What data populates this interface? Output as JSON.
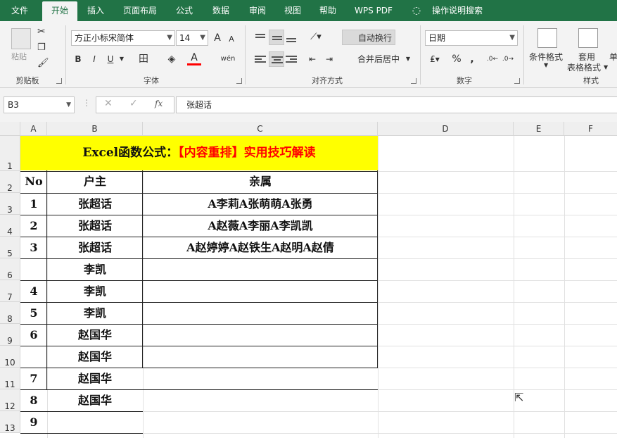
{
  "menu": {
    "tabs": [
      "文件",
      "开始",
      "插入",
      "页面布局",
      "公式",
      "数据",
      "审阅",
      "视图",
      "帮助",
      "WPS PDF",
      "操作说明搜索"
    ]
  },
  "ribbon": {
    "paste_label": "粘贴",
    "font_name": "方正小标宋简体",
    "font_size": "14",
    "grow_font": "A",
    "shrink_font": "A",
    "bold": "B",
    "italic": "I",
    "underline": "U",
    "font_color_a": "A",
    "phonetic": "wén",
    "wrap_text": "自动换行",
    "merge_center": "合并后居中",
    "number_format": "日期",
    "percent": "%",
    "comma": ",",
    "cond_format": "条件格式",
    "format_table_line1": "套用",
    "format_table_line2": "表格格式",
    "cell_styles_partial": "单",
    "groups": {
      "clipboard": "剪贴板",
      "font": "字体",
      "alignment": "对齐方式",
      "number": "数字",
      "styles": "样式"
    }
  },
  "formula_bar": {
    "name_box": "B3",
    "fx": "fx",
    "content": "张超话"
  },
  "sheet": {
    "columns": [
      "A",
      "B",
      "C",
      "D",
      "E",
      "F"
    ],
    "rows": [
      "1",
      "2",
      "3",
      "4",
      "5",
      "6",
      "7",
      "8",
      "9",
      "10",
      "11",
      "12",
      "13"
    ],
    "title_black": "Excel函数公式：",
    "title_red": "【内容重排】实用技巧解读",
    "header": {
      "no": "No",
      "owner": "户主",
      "relatives": "亲属"
    },
    "data_rows": [
      {
        "no": "1",
        "owner": "张超话",
        "relatives": "A李莉A张萌萌A张勇"
      },
      {
        "no": "2",
        "owner": "张超话",
        "relatives": "A赵薇A李丽A李凯凯"
      },
      {
        "no": "3",
        "owner": "张超话",
        "relatives": "A赵婷婷A赵铁生A赵明A赵倩"
      },
      {
        "no": "",
        "owner": "李凯",
        "relatives": ""
      },
      {
        "no": "4",
        "owner": "李凯",
        "relatives": ""
      },
      {
        "no": "5",
        "owner": "李凯",
        "relatives": ""
      },
      {
        "no": "6",
        "owner": "赵国华",
        "relatives": ""
      },
      {
        "no": "",
        "owner": "赵国华",
        "relatives": ""
      },
      {
        "no": "7",
        "owner": "赵国华",
        "relatives": ""
      },
      {
        "no": "8",
        "owner": "赵国华",
        "relatives": ""
      },
      {
        "no": "9",
        "owner": "",
        "relatives": ""
      }
    ]
  },
  "colors": {
    "brand": "#217346",
    "title_fill": "#ffff00",
    "title_red": "#ff0000"
  }
}
